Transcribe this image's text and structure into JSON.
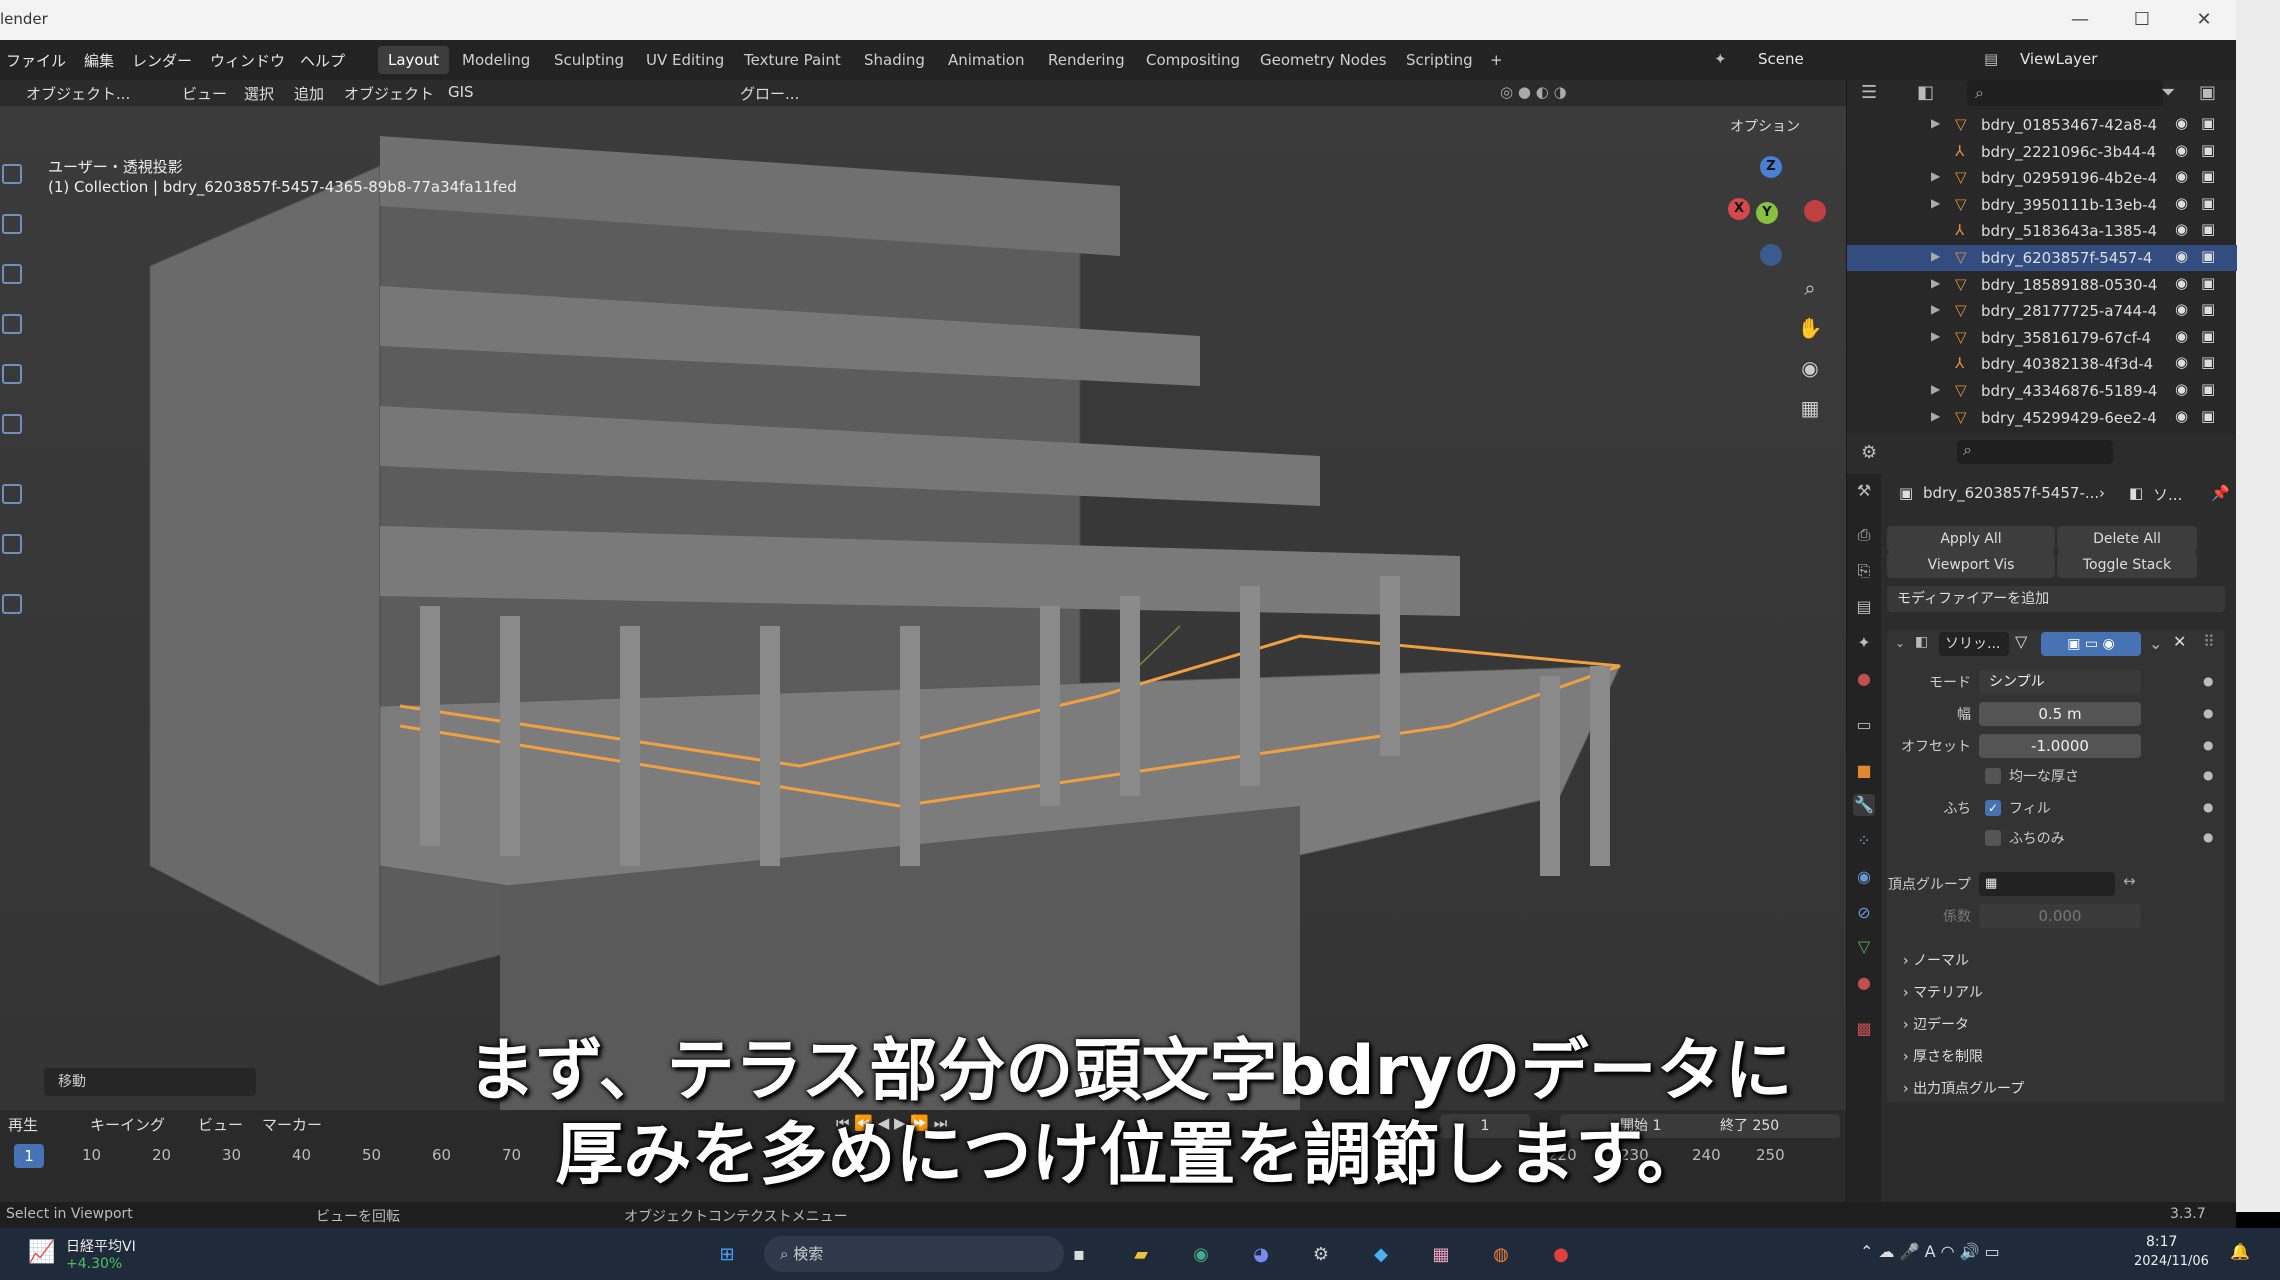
{
  "window": {
    "title": "lender"
  },
  "menu": [
    "ファイル",
    "編集",
    "レンダー",
    "ウィンドウ",
    "ヘルプ"
  ],
  "workspaces": [
    "Layout",
    "Modeling",
    "Sculpting",
    "UV Editing",
    "Texture Paint",
    "Shading",
    "Animation",
    "Rendering",
    "Compositing",
    "Geometry Nodes",
    "Scripting"
  ],
  "workspace_add": "+",
  "scene": {
    "label": "Scene",
    "view_layer": "ViewLayer"
  },
  "header": {
    "mode": "オブジェクト...",
    "items": [
      "ビュー",
      "選択",
      "追加",
      "オブジェクト",
      "GIS"
    ],
    "transform": "グロー...",
    "options": "オプション"
  },
  "viewport": {
    "view_name": "ユーザー・透視投影",
    "collection_info": "(1) Collection | bdry_6203857f-5457-4365-89b8-77a34fa11fed",
    "last_operator": "移動",
    "gizmo": {
      "x": "X",
      "y": "Y",
      "z": "Z"
    }
  },
  "timeline": {
    "menus": [
      "再生",
      "キーイング",
      "ビュー",
      "マーカー"
    ],
    "current_frame": "1",
    "frames": [
      "10",
      "20",
      "30",
      "40",
      "50",
      "60",
      "70",
      "220",
      "230",
      "240",
      "250"
    ],
    "frame_field": "1",
    "start_label": "開始",
    "start": "1",
    "end_label": "終了",
    "end": "250"
  },
  "statusbar": {
    "left": "Select in Viewport",
    "middle": "ビューを回転",
    "context": "オブジェクトコンテクストメニュー",
    "version": "3.3.7"
  },
  "outliner": {
    "items": [
      {
        "name": "bdry_01853467-42a8-4",
        "type": "mesh",
        "selected": false
      },
      {
        "name": "bdry_2221096c-3b44-4",
        "type": "empty",
        "selected": false
      },
      {
        "name": "bdry_02959196-4b2e-4",
        "type": "mesh",
        "selected": false
      },
      {
        "name": "bdry_3950111b-13eb-4",
        "type": "mesh",
        "selected": false
      },
      {
        "name": "bdry_5183643a-1385-4",
        "type": "empty",
        "selected": false
      },
      {
        "name": "bdry_6203857f-5457-4",
        "type": "mesh",
        "selected": true
      },
      {
        "name": "bdry_18589188-0530-4",
        "type": "mesh",
        "selected": false
      },
      {
        "name": "bdry_28177725-a744-4",
        "type": "mesh",
        "selected": false
      },
      {
        "name": "bdry_35816179-67cf-4",
        "type": "mesh",
        "selected": false
      },
      {
        "name": "bdry_40382138-4f3d-4",
        "type": "empty",
        "selected": false
      },
      {
        "name": "bdry_43346876-5189-4",
        "type": "mesh",
        "selected": false
      },
      {
        "name": "bdry_45299429-6ee2-4",
        "type": "mesh",
        "selected": false
      }
    ]
  },
  "properties": {
    "object_name": "bdry_6203857f-5457-...",
    "object_suffix": "ソ...",
    "apply_all": "Apply All",
    "delete_all": "Delete All",
    "viewport_vis": "Viewport Vis",
    "toggle_stack": "Toggle Stack",
    "add_modifier": "モディファイアーを追加",
    "modifier_name": "ソリッ...",
    "mode_label": "モード",
    "mode_value": "シンプル",
    "width_label": "幅",
    "width_value": "0.5 m",
    "offset_label": "オフセット",
    "offset_value": "-1.0000",
    "even_thickness": "均一な厚さ",
    "rim_label": "ふち",
    "rim_fill": "フィル",
    "rim_only": "ふちのみ",
    "vertex_group_label": "頂点グループ",
    "factor_label": "係数",
    "factor_value": "0.000",
    "subpanels": [
      "ノーマル",
      "マテリアル",
      "辺データ",
      "厚さを制限",
      "出力頂点グループ"
    ]
  },
  "taskbar": {
    "stock_name": "日経平均VI",
    "stock_change": "+4.30%",
    "search": "検索",
    "time": "8:17",
    "date": "2024/11/06"
  },
  "subtitle": {
    "line1": "まず、テラス部分の頭文字bdryのデータに",
    "line2": "厚みを多めにつけ位置を調節します。"
  },
  "colors": {
    "accent": "#4772b3",
    "selection_outline": "#f0a040",
    "selected_row": "#334d80"
  }
}
